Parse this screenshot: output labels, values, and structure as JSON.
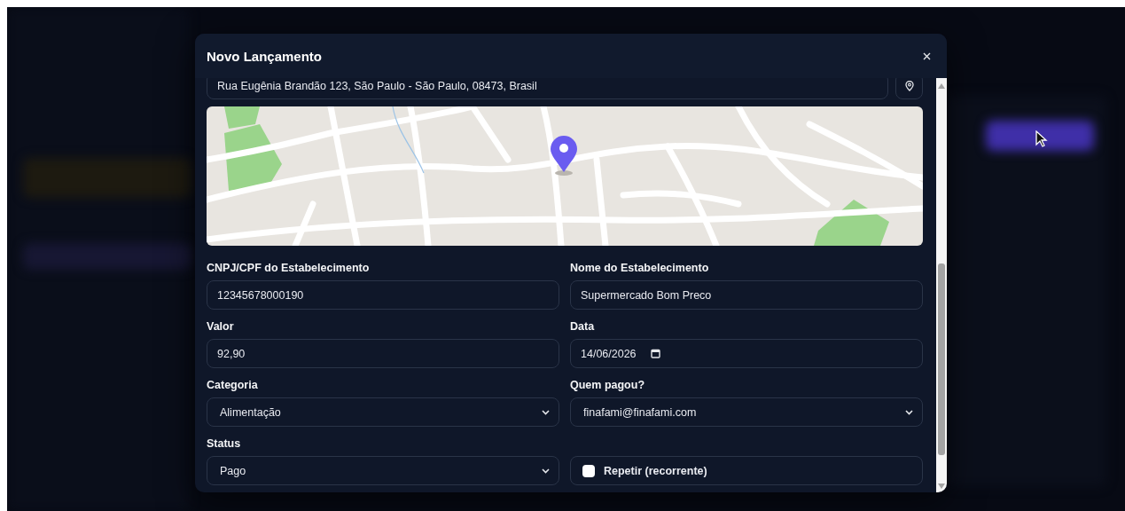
{
  "dialog": {
    "title": "Novo Lançamento",
    "address": {
      "value": "Rua Eugênia Brandão 123, São Paulo - São Paulo, 08473, Brasil"
    },
    "fields": [
      {
        "kind": "text",
        "label": "CNPJ/CPF do Estabelecimento",
        "value": "12345678000190"
      },
      {
        "kind": "text",
        "label": "Nome do Estabelecimento",
        "value": "Supermercado Bom Preco"
      },
      {
        "kind": "text",
        "label": "Valor",
        "value": "92,90"
      },
      {
        "kind": "date",
        "label": "Data",
        "value": "14/06/2026"
      },
      {
        "kind": "select",
        "label": "Categoria",
        "value": "Alimentação"
      },
      {
        "kind": "select",
        "label": "Quem pagou?",
        "value": "finafami@finafami.com"
      },
      {
        "kind": "select",
        "label": "Status",
        "value": "Pago"
      }
    ],
    "recurring": {
      "label": "Repetir (recorrente)",
      "checked": false
    }
  }
}
